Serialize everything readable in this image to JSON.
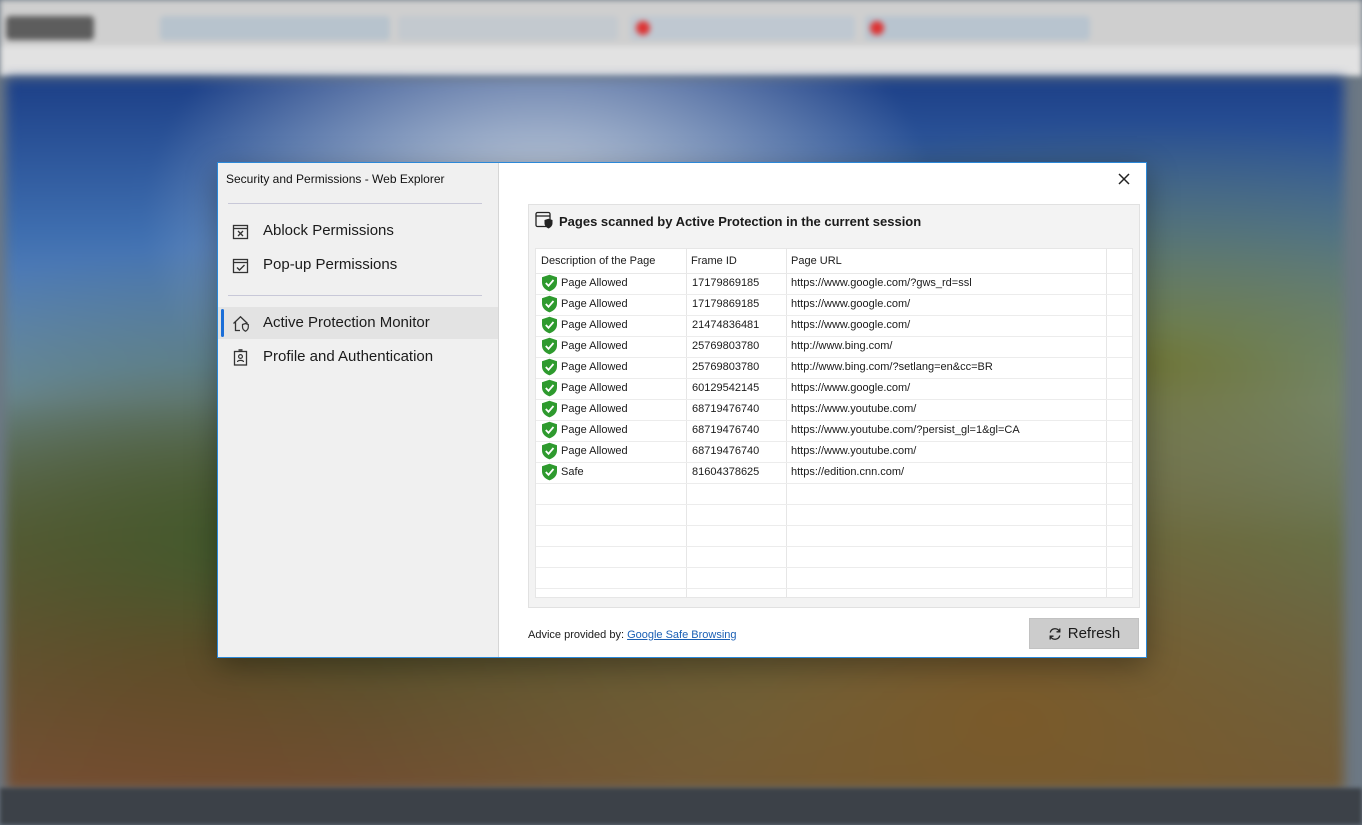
{
  "dialog": {
    "title": "Security and Permissions - Web Explorer",
    "close_icon": "close-icon"
  },
  "sidebar": {
    "items": [
      {
        "label": "Ablock Permissions",
        "icon": "ablock-icon",
        "active": false
      },
      {
        "label": "Pop-up Permissions",
        "icon": "popup-check-icon",
        "active": false
      },
      {
        "label": "Active Protection Monitor",
        "icon": "home-shield-icon",
        "active": true
      },
      {
        "label": "Profile and Authentication",
        "icon": "profile-badge-icon",
        "active": false
      }
    ]
  },
  "panel": {
    "title": "Pages scanned by Active Protection in the current session",
    "icon": "browser-shield-icon"
  },
  "table": {
    "columns": [
      "Description of the Page",
      "Frame ID",
      "Page URL"
    ],
    "rows": [
      {
        "status": "Page Allowed",
        "frame_id": "17179869185",
        "url": "https://www.google.com/?gws_rd=ssl"
      },
      {
        "status": "Page Allowed",
        "frame_id": "17179869185",
        "url": "https://www.google.com/"
      },
      {
        "status": "Page Allowed",
        "frame_id": "21474836481",
        "url": "https://www.google.com/"
      },
      {
        "status": "Page Allowed",
        "frame_id": "25769803780",
        "url": "http://www.bing.com/"
      },
      {
        "status": "Page Allowed",
        "frame_id": "25769803780",
        "url": "http://www.bing.com/?setlang=en&cc=BR"
      },
      {
        "status": "Page Allowed",
        "frame_id": "60129542145",
        "url": "https://www.google.com/"
      },
      {
        "status": "Page Allowed",
        "frame_id": "68719476740",
        "url": "https://www.youtube.com/"
      },
      {
        "status": "Page Allowed",
        "frame_id": "68719476740",
        "url": "https://www.youtube.com/?persist_gl=1&gl=CA"
      },
      {
        "status": "Page Allowed",
        "frame_id": "68719476740",
        "url": "https://www.youtube.com/"
      },
      {
        "status": "Safe",
        "frame_id": "81604378625",
        "url": "https://edition.cnn.com/"
      }
    ],
    "empty_rows": 6
  },
  "footer": {
    "advice_prefix": "Advice provided by:",
    "advice_link": "Google Safe Browsing",
    "refresh_label": "Refresh"
  },
  "colors": {
    "accent": "#1a6ed8",
    "shield_green": "#2e9a2e",
    "link": "#1a5fb4"
  }
}
